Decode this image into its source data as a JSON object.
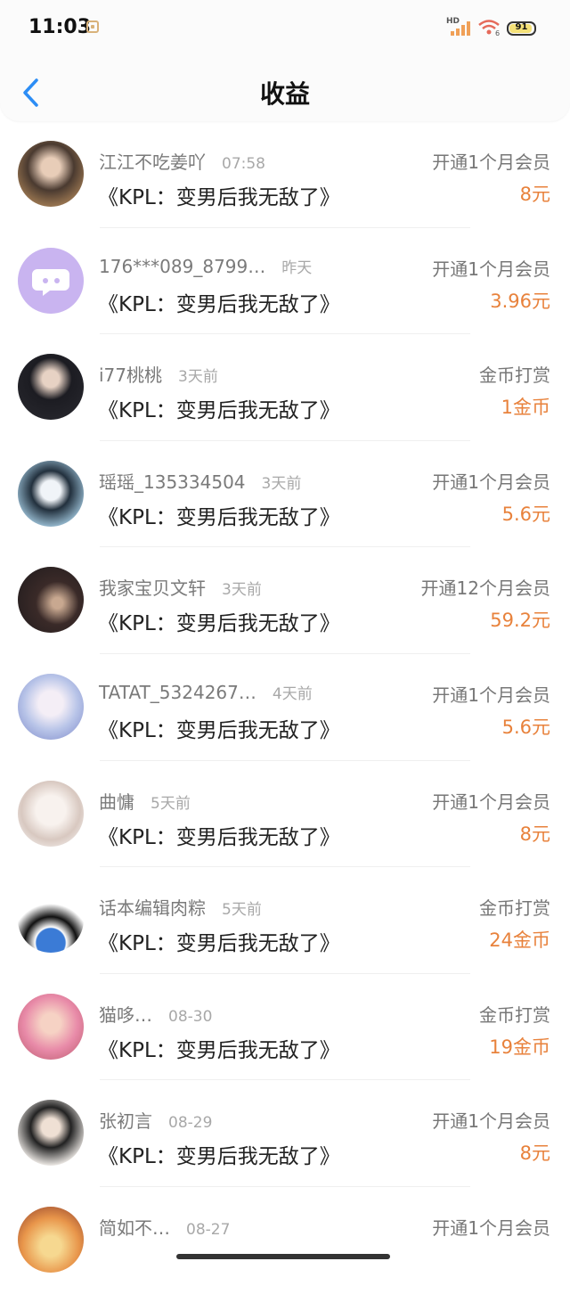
{
  "status_bar": {
    "time": "11:03",
    "hd_label": "HD",
    "wifi_badge": "6",
    "battery_level": "91",
    "battery_fraction": 0.91
  },
  "header": {
    "title": "收益",
    "back_icon": "chevron-left-icon",
    "accent_color": "#2c8df5"
  },
  "colors": {
    "amount": "#e8823c"
  },
  "records": [
    {
      "name": "江江不吃姜吖",
      "time": "07:58",
      "book": "《KPL：变男后我无敌了》",
      "type": "开通1个月会员",
      "amount": "8元"
    },
    {
      "name": "176***089_8799…",
      "time": "昨天",
      "book": "《KPL：变男后我无敌了》",
      "type": "开通1个月会员",
      "amount": "3.96元"
    },
    {
      "name": "i77桃桃",
      "time": "3天前",
      "book": "《KPL：变男后我无敌了》",
      "type": "金币打赏",
      "amount": "1金币"
    },
    {
      "name": "瑶瑶_135334504",
      "time": "3天前",
      "book": "《KPL：变男后我无敌了》",
      "type": "开通1个月会员",
      "amount": "5.6元"
    },
    {
      "name": "我家宝贝文轩",
      "time": "3天前",
      "book": "《KPL：变男后我无敌了》",
      "type": "开通12个月会员",
      "amount": "59.2元"
    },
    {
      "name": "TATAT_5324267…",
      "time": "4天前",
      "book": "《KPL：变男后我无敌了》",
      "type": "开通1个月会员",
      "amount": "5.6元"
    },
    {
      "name": "曲慵",
      "time": "5天前",
      "book": "《KPL：变男后我无敌了》",
      "type": "开通1个月会员",
      "amount": "8元"
    },
    {
      "name": "话本编辑肉粽",
      "time": "5天前",
      "book": "《KPL：变男后我无敌了》",
      "type": "金币打赏",
      "amount": "24金币"
    },
    {
      "name": "猫哆…",
      "time": "08-30",
      "book": "《KPL：变男后我无敌了》",
      "type": "金币打赏",
      "amount": "19金币"
    },
    {
      "name": "张初言",
      "time": "08-29",
      "book": "《KPL：变男后我无敌了》",
      "type": "开通1个月会员",
      "amount": "8元"
    },
    {
      "name": "简如不…",
      "time": "08-27",
      "book": "",
      "type": "开通1个月会员",
      "amount": ""
    }
  ]
}
